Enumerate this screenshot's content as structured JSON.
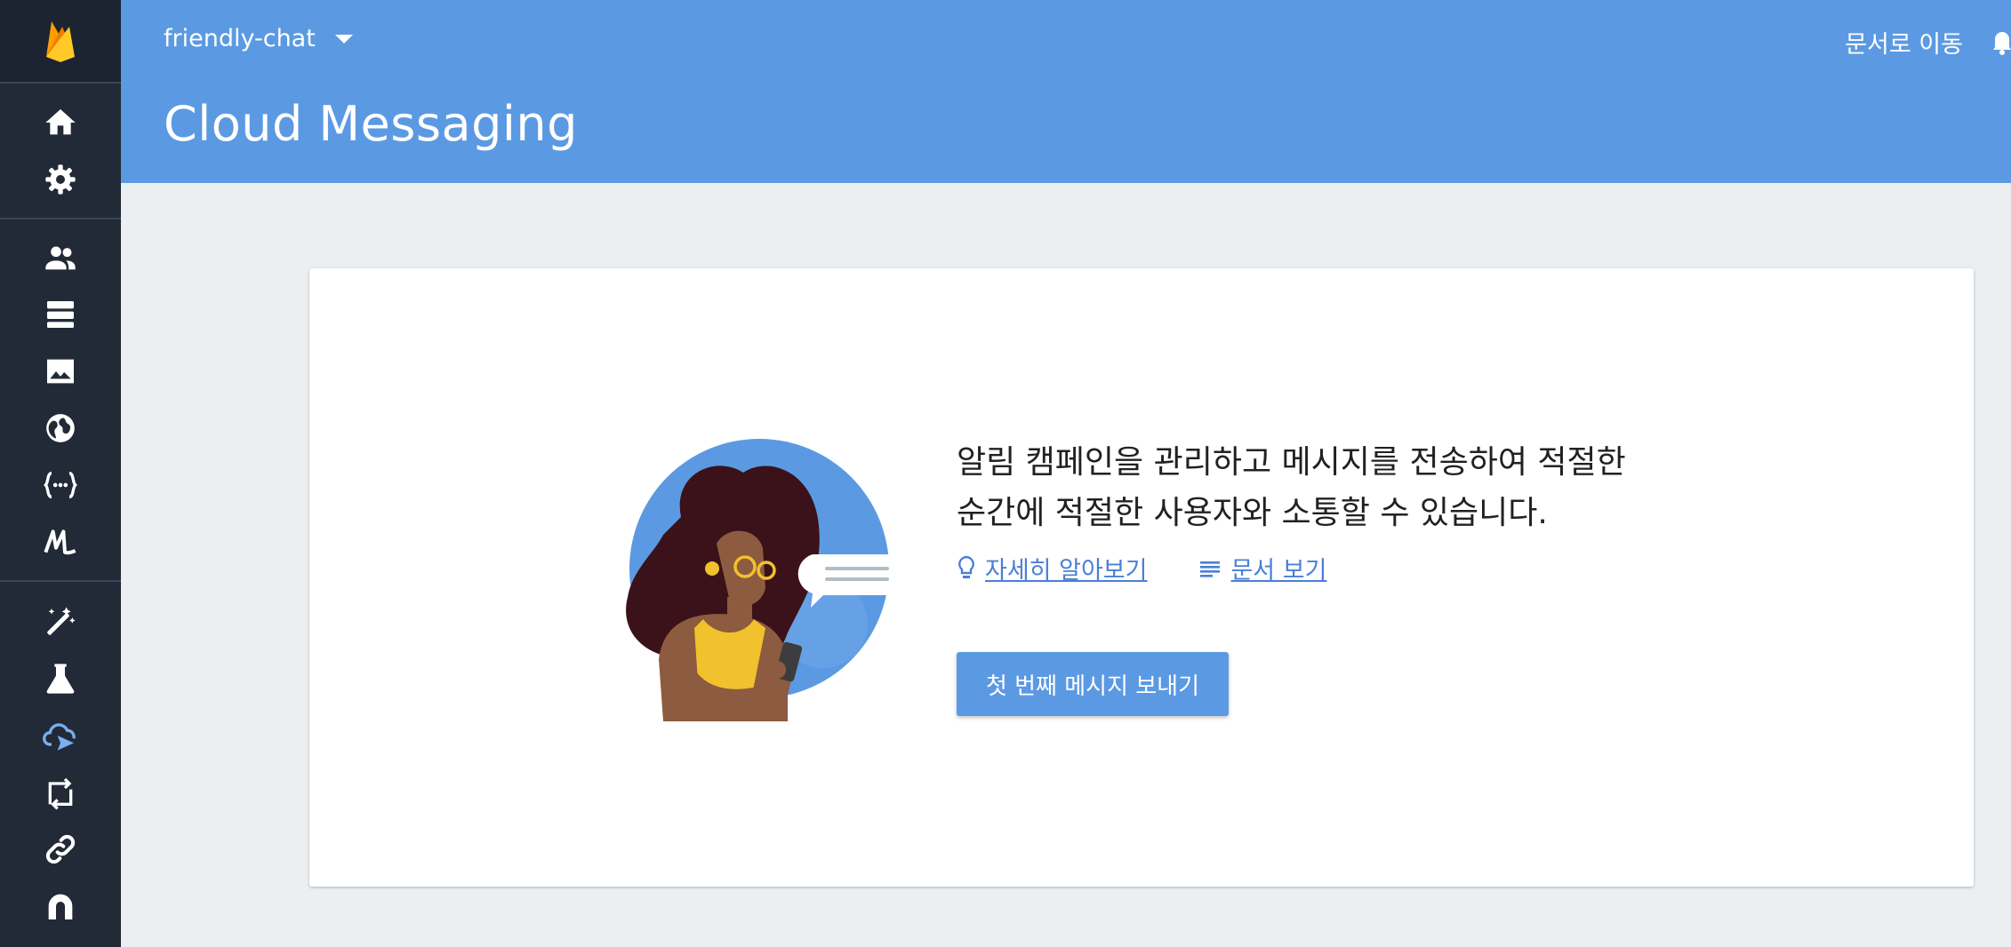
{
  "sidebar": {
    "logo_icon": "firebase-flame-icon",
    "items": [
      {
        "icon": "home-icon",
        "label": "Home"
      },
      {
        "icon": "gear-icon",
        "label": "Settings"
      },
      {
        "icon": "people-icon",
        "label": "Authentication"
      },
      {
        "icon": "database-icon",
        "label": "Database"
      },
      {
        "icon": "image-icon",
        "label": "Storage"
      },
      {
        "icon": "globe-icon",
        "label": "Hosting"
      },
      {
        "icon": "functions-icon",
        "label": "Functions"
      },
      {
        "icon": "ml-icon",
        "label": "ML Kit"
      },
      {
        "icon": "magic-wand-icon",
        "label": "Crashlytics"
      },
      {
        "icon": "flask-icon",
        "label": "Test Lab"
      },
      {
        "icon": "cloud-messaging-icon",
        "label": "Cloud Messaging"
      },
      {
        "icon": "remote-config-icon",
        "label": "Remote Config"
      },
      {
        "icon": "link-icon",
        "label": "Dynamic Links"
      },
      {
        "icon": "app-distribution-icon",
        "label": "App Distribution"
      }
    ],
    "active_color": "#7aaef0"
  },
  "header": {
    "project_name": "friendly-chat",
    "title": "Cloud Messaging",
    "go_to_docs": "문서로 이동",
    "background": "#5b9ae2"
  },
  "card": {
    "lead_line1": "알림 캠페인을 관리하고 메시지를 전송하여 적절한",
    "lead_line2": "순간에 적절한 사용자와 소통할 수 있습니다.",
    "learn_more": "자세히 알아보기",
    "view_docs": "문서 보기",
    "cta": "첫 번째 메시지 보내기"
  }
}
